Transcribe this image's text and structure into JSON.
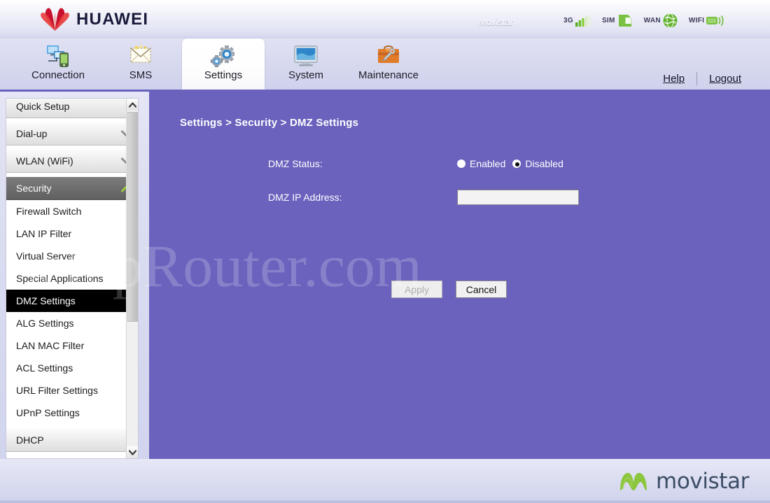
{
  "brand": {
    "logo_text": "HUAWEI",
    "carrier": "Movistar"
  },
  "status_icons": [
    {
      "label": "3G",
      "icon": "signal-bars-icon"
    },
    {
      "label": "SIM",
      "icon": "sim-card-icon"
    },
    {
      "label": "WAN",
      "icon": "globe-icon"
    },
    {
      "label": "WIFI",
      "icon": "wifi-icon"
    }
  ],
  "nav": {
    "items": [
      {
        "label": "Connection",
        "icon": "connection-icon",
        "active": false
      },
      {
        "label": "SMS",
        "icon": "envelope-icon",
        "active": false
      },
      {
        "label": "Settings",
        "icon": "gear-icon",
        "active": true
      },
      {
        "label": "System",
        "icon": "monitor-icon",
        "active": false
      },
      {
        "label": "Maintenance",
        "icon": "toolbox-icon",
        "active": false
      }
    ],
    "help_label": "Help",
    "logout_label": "Logout"
  },
  "sidebar": {
    "groups": [
      {
        "label": "Quick Setup",
        "type": "plain",
        "state": "none"
      },
      {
        "label": "Dial-up",
        "type": "collapsible",
        "state": "collapsed"
      },
      {
        "label": "WLAN (WiFi)",
        "type": "collapsible",
        "state": "collapsed"
      },
      {
        "label": "Security",
        "type": "collapsible",
        "state": "expanded"
      }
    ],
    "security_items": [
      {
        "label": "Firewall Switch",
        "selected": false
      },
      {
        "label": "LAN IP Filter",
        "selected": false
      },
      {
        "label": "Virtual Server",
        "selected": false
      },
      {
        "label": "Special Applications",
        "selected": false
      },
      {
        "label": "DMZ Settings",
        "selected": true
      },
      {
        "label": "ALG Settings",
        "selected": false
      },
      {
        "label": "LAN MAC Filter",
        "selected": false
      },
      {
        "label": "ACL Settings",
        "selected": false
      },
      {
        "label": "URL Filter Settings",
        "selected": false
      },
      {
        "label": "UPnP Settings",
        "selected": false
      }
    ],
    "trailing_group": {
      "label": "DHCP"
    }
  },
  "main": {
    "breadcrumb": "Settings > Security > DMZ Settings",
    "fields": {
      "dmz_status_label": "DMZ Status:",
      "dmz_status_options": [
        {
          "label": "Enabled",
          "selected": false
        },
        {
          "label": "Disabled",
          "selected": true
        }
      ],
      "dmz_ip_label": "DMZ IP Address:",
      "dmz_ip_value": "",
      "dmz_ip_placeholder": ""
    },
    "buttons": {
      "apply_label": "Apply",
      "apply_disabled": true,
      "cancel_label": "Cancel"
    }
  },
  "watermark": "SetupRouter.com",
  "footer": {
    "logo_text": "movistar"
  },
  "colors": {
    "panel_purple": "#6a62bd",
    "selected_item": "#000000",
    "group_open": "#6e6e6e",
    "accent_green": "#8dc63f",
    "huawei_red": "#d91c2a",
    "movistar_green": "#8cc63e",
    "movistar_blue": "#3c4d66"
  }
}
